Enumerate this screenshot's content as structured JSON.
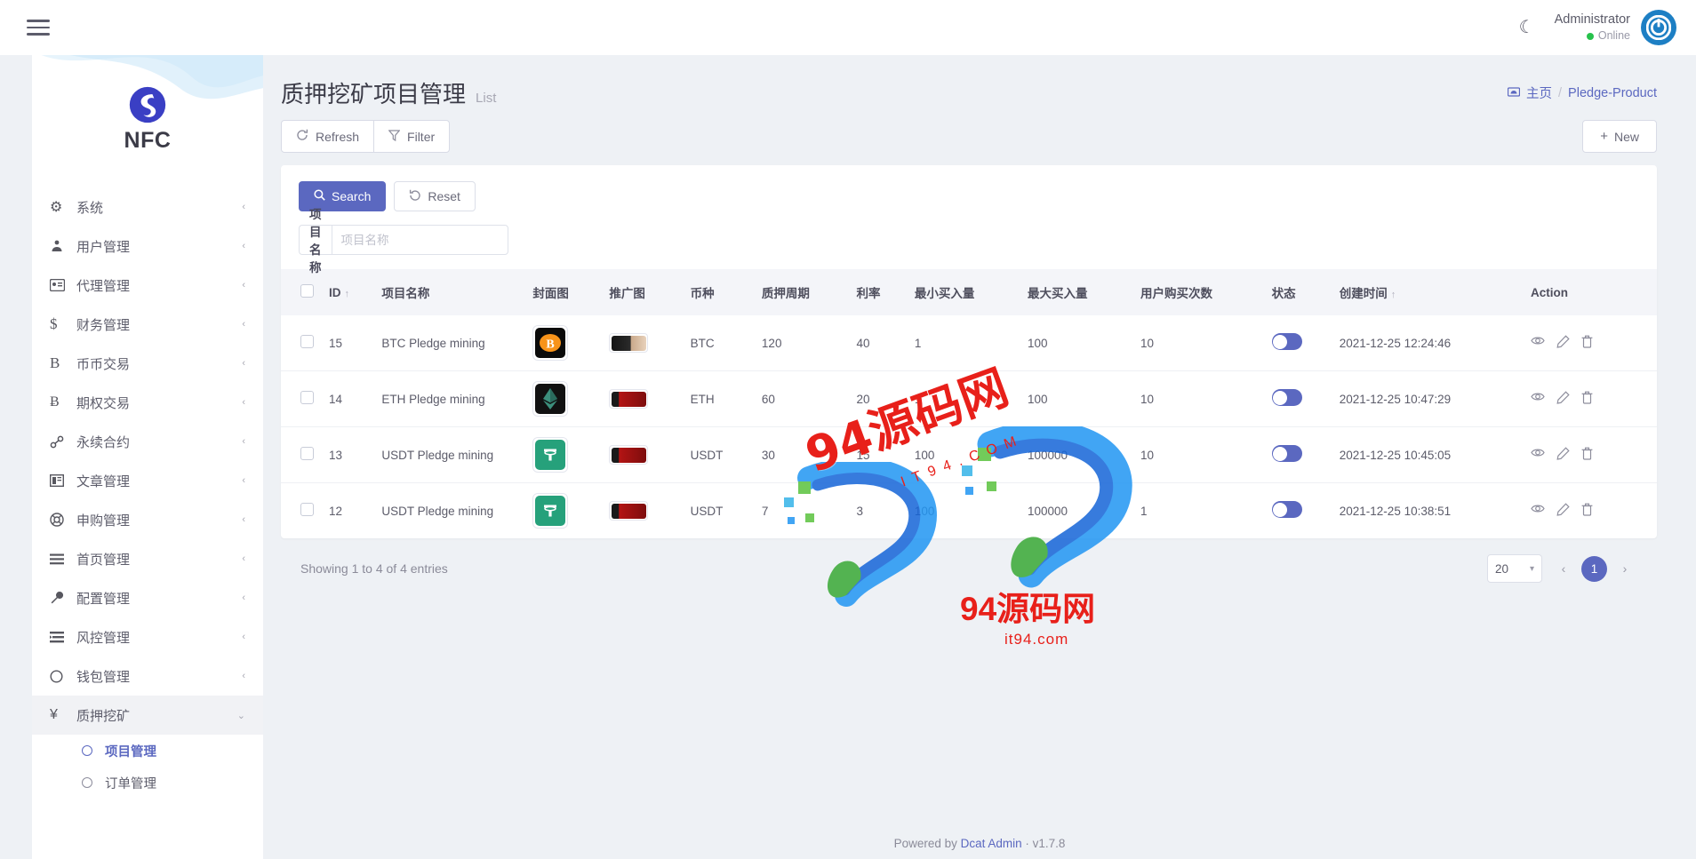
{
  "topbar": {
    "menu_icon": "hamburger-icon",
    "theme_icon": "moon-icon",
    "user_name": "Administrator",
    "user_status": "Online",
    "avatar_icon": "power-avatar-icon"
  },
  "sidebar": {
    "brand": "NFC",
    "items": [
      {
        "label": "系统",
        "icon": "gear-icon",
        "glyph": "⚙",
        "caret": "‹",
        "active": false
      },
      {
        "label": "用户管理",
        "icon": "users-icon",
        "glyph": "♟",
        "caret": "‹",
        "active": false
      },
      {
        "label": "代理管理",
        "icon": "id-card-icon",
        "glyph": "Ὄ7",
        "caret": "‹",
        "active": false
      },
      {
        "label": "财务管理",
        "icon": "dollar-icon",
        "glyph": "$",
        "caret": "‹",
        "active": false
      },
      {
        "label": "币币交易",
        "icon": "letter-b-icon",
        "glyph": "B",
        "caret": "‹",
        "active": false
      },
      {
        "label": "期权交易",
        "icon": "bitcoin-icon",
        "glyph": "Ƀ",
        "caret": "‹",
        "active": false
      },
      {
        "label": "永续合约",
        "icon": "link-icon",
        "glyph": "ὑ7",
        "caret": "‹",
        "active": false
      },
      {
        "label": "文章管理",
        "icon": "article-icon",
        "glyph": "▣",
        "caret": "‹",
        "active": false
      },
      {
        "label": "申购管理",
        "icon": "lifebuoy-icon",
        "glyph": "☸",
        "caret": "‹",
        "active": false
      },
      {
        "label": "首页管理",
        "icon": "lines-icon",
        "glyph": "≡",
        "caret": "‹",
        "active": false
      },
      {
        "label": "配置管理",
        "icon": "wrench-icon",
        "glyph": "ὒ7",
        "caret": "‹",
        "active": false
      },
      {
        "label": "风控管理",
        "icon": "list-alt-icon",
        "glyph": "☰",
        "caret": "‹",
        "active": false
      },
      {
        "label": "钱包管理",
        "icon": "circle-icon",
        "glyph": "◯",
        "caret": "‹",
        "active": false
      },
      {
        "label": "质押挖矿",
        "icon": "yen-icon",
        "glyph": "¥",
        "caret": "⌄",
        "active": true
      }
    ],
    "submenu": [
      {
        "label": "项目管理",
        "active": true
      },
      {
        "label": "订单管理",
        "active": false
      }
    ]
  },
  "page": {
    "title": "质押挖矿项目管理",
    "subtitle": "List",
    "breadcrumb_home": "主页",
    "breadcrumb_sep": "/",
    "breadcrumb_current": "Pledge-Product"
  },
  "toolbar": {
    "refresh_label": "Refresh",
    "filter_label": "Filter",
    "new_label": "New",
    "refresh_icon": "refresh-icon",
    "filter_icon": "funnel-icon",
    "new_icon": "plus-icon"
  },
  "filter": {
    "search_label": "Search",
    "reset_label": "Reset",
    "search_icon": "search-icon",
    "reset_icon": "undo-icon",
    "field_label": "项目名称",
    "field_value": "",
    "field_placeholder": "项目名称"
  },
  "table": {
    "columns": [
      "ID",
      "项目名称",
      "封面图",
      "推广图",
      "币种",
      "质押周期",
      "利率",
      "最小买入量",
      "最大买入量",
      "用户购买次数",
      "状态",
      "创建时间",
      "Action"
    ],
    "sorted_columns": [
      "ID",
      "创建时间"
    ],
    "sort_glyph": "↑",
    "rows": [
      {
        "id": "15",
        "name": "BTC Pledge mining",
        "cover_icon": "bitcoin-logo",
        "cover_color": "#f7931a",
        "cover_bg": "#0a0a0a",
        "cover_glyph": "₿",
        "promo_color": "#1b1b1b",
        "coin": "BTC",
        "period": "120",
        "rate": "40",
        "min_buy": "1",
        "max_buy": "100",
        "buy_times": "10",
        "status_on": true,
        "created_at": "2021-12-25 12:24:46"
      },
      {
        "id": "14",
        "name": "ETH Pledge mining",
        "cover_icon": "ethereum-logo",
        "cover_color": "#ffffff",
        "cover_bg": "#111111",
        "cover_glyph": "◆",
        "promo_color": "#b01818",
        "coin": "ETH",
        "period": "60",
        "rate": "20",
        "min_buy": "1",
        "max_buy": "100",
        "buy_times": "10",
        "status_on": true,
        "created_at": "2021-12-25 10:47:29"
      },
      {
        "id": "13",
        "name": "USDT Pledge mining",
        "cover_icon": "tether-logo",
        "cover_color": "#ffffff",
        "cover_bg": "#26a17b",
        "cover_glyph": "₮",
        "promo_color": "#b01818",
        "coin": "USDT",
        "period": "30",
        "rate": "15",
        "min_buy": "100",
        "max_buy": "100000",
        "buy_times": "10",
        "status_on": true,
        "created_at": "2021-12-25 10:45:05"
      },
      {
        "id": "12",
        "name": "USDT Pledge mining",
        "cover_icon": "tether-logo",
        "cover_color": "#ffffff",
        "cover_bg": "#26a17b",
        "cover_glyph": "₮",
        "promo_color": "#b01818",
        "coin": "USDT",
        "period": "7",
        "rate": "3",
        "min_buy": "100",
        "max_buy": "100000",
        "buy_times": "1",
        "status_on": true,
        "created_at": "2021-12-25 10:38:51"
      }
    ],
    "action_icons": [
      "eye-icon",
      "pencil-icon",
      "trash-icon"
    ]
  },
  "pagination": {
    "showing_text": "Showing 1 to 4 of 4 entries",
    "per_page": "20",
    "prev_glyph": "‹",
    "next_glyph": "›",
    "current_page": "1"
  },
  "footer": {
    "prefix": "Powered by ",
    "brand": "Dcat Admin",
    "suffix": " · v1.7.8"
  },
  "watermark": {
    "line1": "94源码网",
    "line2": "IT94.COM",
    "line3": "94源码网",
    "line4": "it94.com"
  },
  "colors": {
    "accent": "#5b68c0",
    "page_bg": "#eef1f5",
    "header_bg": "#f4f5f9",
    "online": "#27c24c"
  }
}
